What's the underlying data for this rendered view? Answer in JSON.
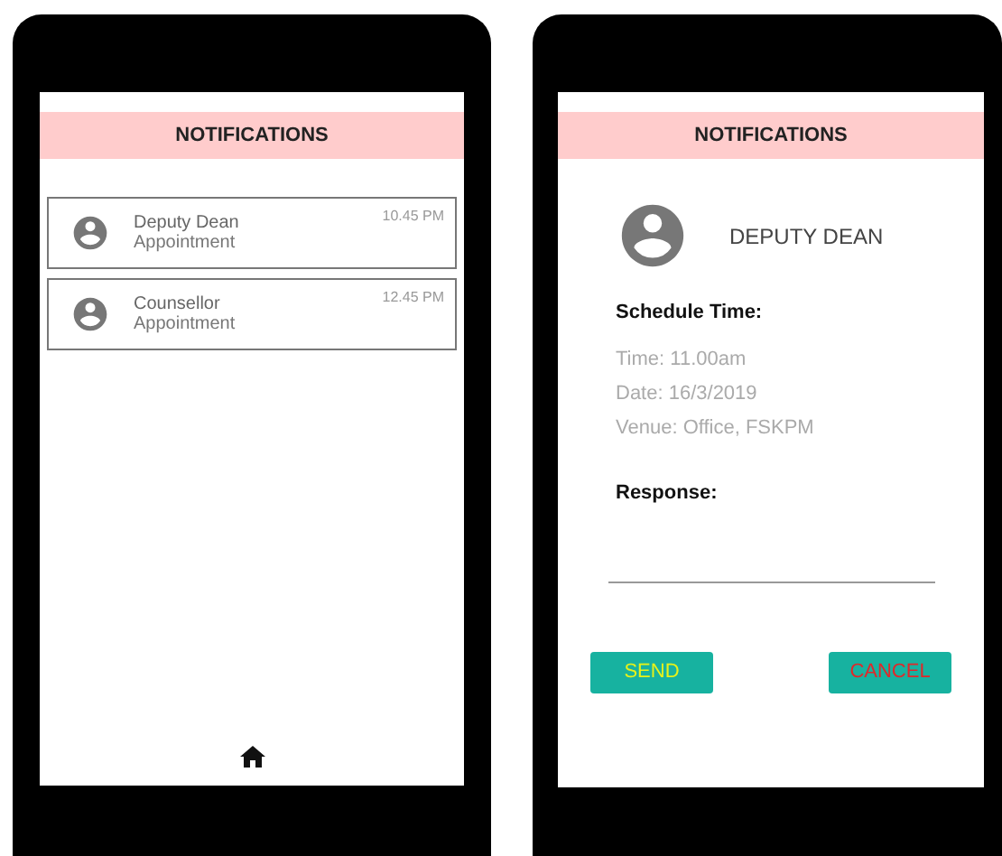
{
  "list_screen": {
    "header": "NOTIFICATIONS",
    "notifications": [
      {
        "sender": "Deputy Dean",
        "subject": "Appointment",
        "time": "10.45 PM"
      },
      {
        "sender": "Counsellor",
        "subject": "Appointment",
        "time": "12.45 PM"
      }
    ]
  },
  "detail_screen": {
    "header": "NOTIFICATIONS",
    "sender": "DEPUTY DEAN",
    "schedule_heading": "Schedule Time:",
    "schedule_lines": [
      "Time: 11.00am",
      "Date: 16/3/2019",
      "Venue: Office, FSKPM"
    ],
    "response_label": "Response:",
    "buttons": [
      {
        "label": "SEND",
        "kind": "send"
      },
      {
        "label": "CANCEL",
        "kind": "cancel"
      }
    ]
  }
}
